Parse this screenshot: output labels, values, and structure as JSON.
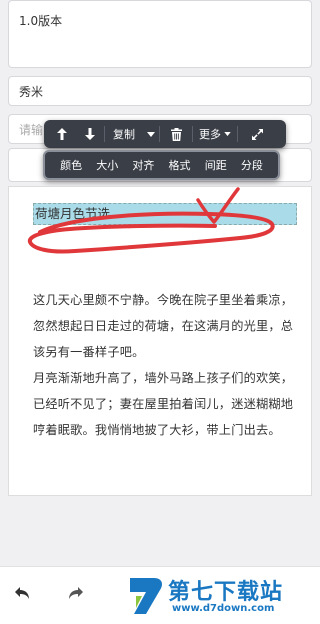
{
  "form": {
    "version_value": "1.0版本",
    "author_value": "秀米",
    "summary_placeholder": "请输"
  },
  "toolbar_primary": {
    "copy_label": "复制",
    "more_label": "更多"
  },
  "toolbar_secondary": {
    "items": [
      "颜色",
      "大小",
      "对齐",
      "格式",
      "间距",
      "分段"
    ]
  },
  "article": {
    "heading": "荷塘月色节选",
    "paragraph1": "这几天心里颇不宁静。今晚在院子里坐着乘凉，忽然想起日日走过的荷塘，在这满月的光里，总该另有一番样子吧。",
    "paragraph2": "月亮渐渐地升高了，墙外马路上孩子们的欢笑，已经听不见了；妻在屋里拍着闰儿，迷迷糊糊地哼着眠歌。我悄悄地披了大衫，带上门出去。"
  },
  "watermark": {
    "brand": "第七下载站",
    "url": "www.d7down.com"
  },
  "colors": {
    "toolbar_bg": "#3a3e47",
    "highlight": "#a9dbe8",
    "scribble": "#e0383a",
    "brand": "#1a78c2"
  }
}
